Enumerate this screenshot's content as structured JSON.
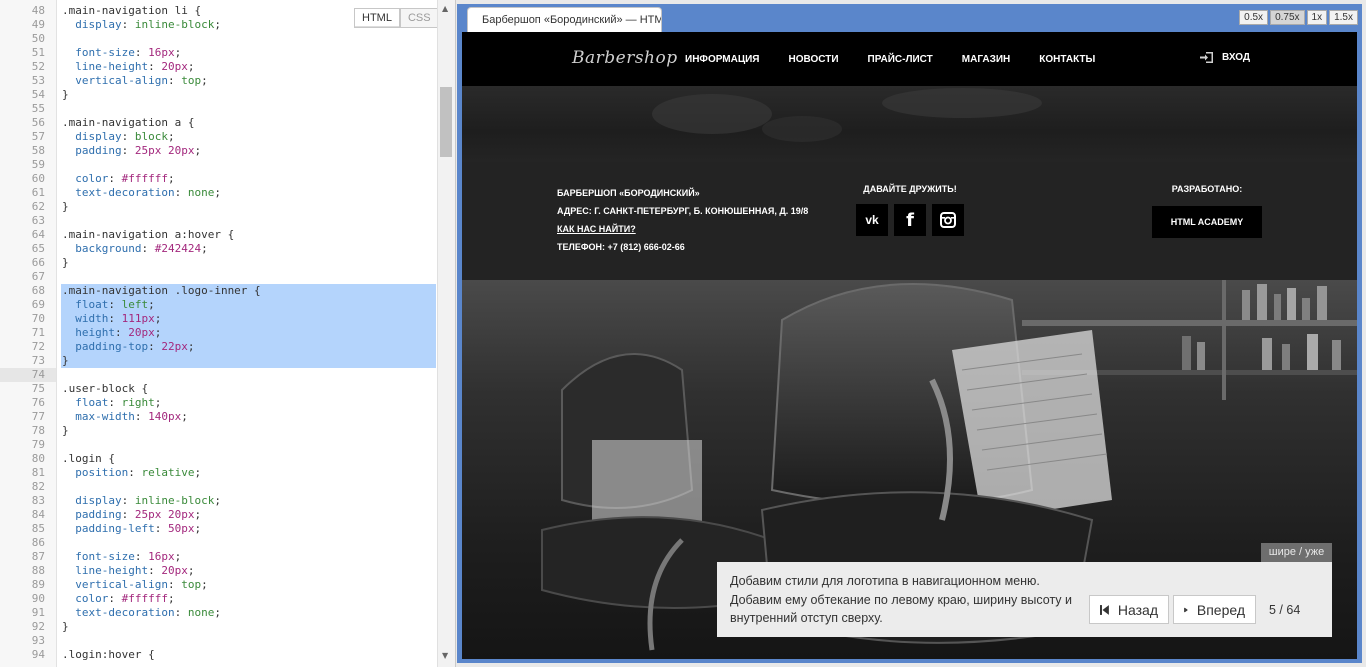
{
  "editor": {
    "mode_tabs": [
      {
        "label": "HTML",
        "active": true
      },
      {
        "label": "CSS",
        "active": false
      }
    ],
    "first_line": 48,
    "selected_lines": [
      68,
      69,
      70,
      71,
      72,
      73
    ],
    "current_line": 74,
    "lines": [
      [
        [
          ".main-navigation li {",
          "sel"
        ]
      ],
      [
        [
          "  display",
          "prop"
        ],
        [
          ": ",
          "p"
        ],
        [
          "inline-block",
          "val"
        ],
        [
          ";",
          "p"
        ]
      ],
      [],
      [
        [
          "  font-size",
          "prop"
        ],
        [
          ": ",
          "p"
        ],
        [
          "16px",
          "num"
        ],
        [
          ";",
          "p"
        ]
      ],
      [
        [
          "  line-height",
          "prop"
        ],
        [
          ": ",
          "p"
        ],
        [
          "20px",
          "num"
        ],
        [
          ";",
          "p"
        ]
      ],
      [
        [
          "  vertical-align",
          "prop"
        ],
        [
          ": ",
          "p"
        ],
        [
          "top",
          "val"
        ],
        [
          ";",
          "p"
        ]
      ],
      [
        [
          "}",
          "p"
        ]
      ],
      [],
      [
        [
          ".main-navigation a {",
          "sel"
        ]
      ],
      [
        [
          "  display",
          "prop"
        ],
        [
          ": ",
          "p"
        ],
        [
          "block",
          "val"
        ],
        [
          ";",
          "p"
        ]
      ],
      [
        [
          "  padding",
          "prop"
        ],
        [
          ": ",
          "p"
        ],
        [
          "25px 20px",
          "num"
        ],
        [
          ";",
          "p"
        ]
      ],
      [],
      [
        [
          "  color",
          "prop"
        ],
        [
          ": ",
          "p"
        ],
        [
          "#ffffff",
          "hex"
        ],
        [
          ";",
          "p"
        ]
      ],
      [
        [
          "  text-decoration",
          "prop"
        ],
        [
          ": ",
          "p"
        ],
        [
          "none",
          "val"
        ],
        [
          ";",
          "p"
        ]
      ],
      [
        [
          "}",
          "p"
        ]
      ],
      [],
      [
        [
          ".main-navigation a:hover {",
          "sel"
        ]
      ],
      [
        [
          "  background",
          "prop"
        ],
        [
          ": ",
          "p"
        ],
        [
          "#242424",
          "hex"
        ],
        [
          ";",
          "p"
        ]
      ],
      [
        [
          "}",
          "p"
        ]
      ],
      [],
      [
        [
          ".main-navigation .logo-inner {",
          "sel"
        ]
      ],
      [
        [
          "  float",
          "prop"
        ],
        [
          ": ",
          "p"
        ],
        [
          "left",
          "val"
        ],
        [
          ";",
          "p"
        ]
      ],
      [
        [
          "  width",
          "prop"
        ],
        [
          ": ",
          "p"
        ],
        [
          "111px",
          "num"
        ],
        [
          ";",
          "p"
        ]
      ],
      [
        [
          "  height",
          "prop"
        ],
        [
          ": ",
          "p"
        ],
        [
          "20px",
          "num"
        ],
        [
          ";",
          "p"
        ]
      ],
      [
        [
          "  padding-top",
          "prop"
        ],
        [
          ": ",
          "p"
        ],
        [
          "22px",
          "num"
        ],
        [
          ";",
          "p"
        ]
      ],
      [
        [
          "}",
          "p"
        ]
      ],
      [],
      [
        [
          ".user-block {",
          "sel"
        ]
      ],
      [
        [
          "  float",
          "prop"
        ],
        [
          ": ",
          "p"
        ],
        [
          "right",
          "val"
        ],
        [
          ";",
          "p"
        ]
      ],
      [
        [
          "  max-width",
          "prop"
        ],
        [
          ": ",
          "p"
        ],
        [
          "140px",
          "num"
        ],
        [
          ";",
          "p"
        ]
      ],
      [
        [
          "}",
          "p"
        ]
      ],
      [],
      [
        [
          ".login {",
          "sel"
        ]
      ],
      [
        [
          "  position",
          "prop"
        ],
        [
          ": ",
          "p"
        ],
        [
          "relative",
          "val"
        ],
        [
          ";",
          "p"
        ]
      ],
      [],
      [
        [
          "  display",
          "prop"
        ],
        [
          ": ",
          "p"
        ],
        [
          "inline-block",
          "val"
        ],
        [
          ";",
          "p"
        ]
      ],
      [
        [
          "  padding",
          "prop"
        ],
        [
          ": ",
          "p"
        ],
        [
          "25px 20px",
          "num"
        ],
        [
          ";",
          "p"
        ]
      ],
      [
        [
          "  padding-left",
          "prop"
        ],
        [
          ": ",
          "p"
        ],
        [
          "50px",
          "num"
        ],
        [
          ";",
          "p"
        ]
      ],
      [],
      [
        [
          "  font-size",
          "prop"
        ],
        [
          ": ",
          "p"
        ],
        [
          "16px",
          "num"
        ],
        [
          ";",
          "p"
        ]
      ],
      [
        [
          "  line-height",
          "prop"
        ],
        [
          ": ",
          "p"
        ],
        [
          "20px",
          "num"
        ],
        [
          ";",
          "p"
        ]
      ],
      [
        [
          "  vertical-align",
          "prop"
        ],
        [
          ": ",
          "p"
        ],
        [
          "top",
          "val"
        ],
        [
          ";",
          "p"
        ]
      ],
      [
        [
          "  color",
          "prop"
        ],
        [
          ": ",
          "p"
        ],
        [
          "#ffffff",
          "hex"
        ],
        [
          ";",
          "p"
        ]
      ],
      [
        [
          "  text-decoration",
          "prop"
        ],
        [
          ": ",
          "p"
        ],
        [
          "none",
          "val"
        ],
        [
          ";",
          "p"
        ]
      ],
      [
        [
          "}",
          "p"
        ]
      ],
      [],
      [
        [
          ".login:hover {",
          "sel"
        ]
      ]
    ]
  },
  "preview": {
    "tab_title": "Барбершоп «Бородинский» — HTML",
    "zoom_levels": [
      "0.5x",
      "0.75x",
      "1x",
      "1.5x"
    ],
    "zoom_active": "0.75x",
    "site": {
      "logo": "Barbershop",
      "nav": [
        "ИНФОРМАЦИЯ",
        "НОВОСТИ",
        "ПРАЙС-ЛИСТ",
        "МАГАЗИН",
        "КОНТАКТЫ"
      ],
      "login": "ВХОД",
      "contacts": {
        "name": "БАРБЕРШОП «БОРОДИНСКИЙ»",
        "address": "АДРЕС: Г. САНКТ-ПЕТЕРБУРГ, Б. КОНЮШЕННАЯ, Д. 19/8",
        "how_to_find": "КАК НАС НАЙТИ?",
        "phone": "ТЕЛЕФОН: +7 (812) 666-02-66"
      },
      "social_title": "ДАВАЙТЕ ДРУЖИТЬ!",
      "social": [
        {
          "name": "vk",
          "glyph": "vk"
        },
        {
          "name": "facebook",
          "glyph": "f"
        },
        {
          "name": "instagram",
          "glyph": ""
        }
      ],
      "developed_title": "РАЗРАБОТАНО:",
      "developer": "HTML ACADEMY"
    }
  },
  "lesson": {
    "resize_label": "шире / уже",
    "instruction_line1": "Добавим стили для логотипа в навигационном меню.",
    "instruction_line2": "Добавим ему обтекание по левому краю, ширину высоту и внутренний отступ сверху.",
    "back_label": "Назад",
    "next_label": "Вперед",
    "progress": "5 / 64"
  }
}
